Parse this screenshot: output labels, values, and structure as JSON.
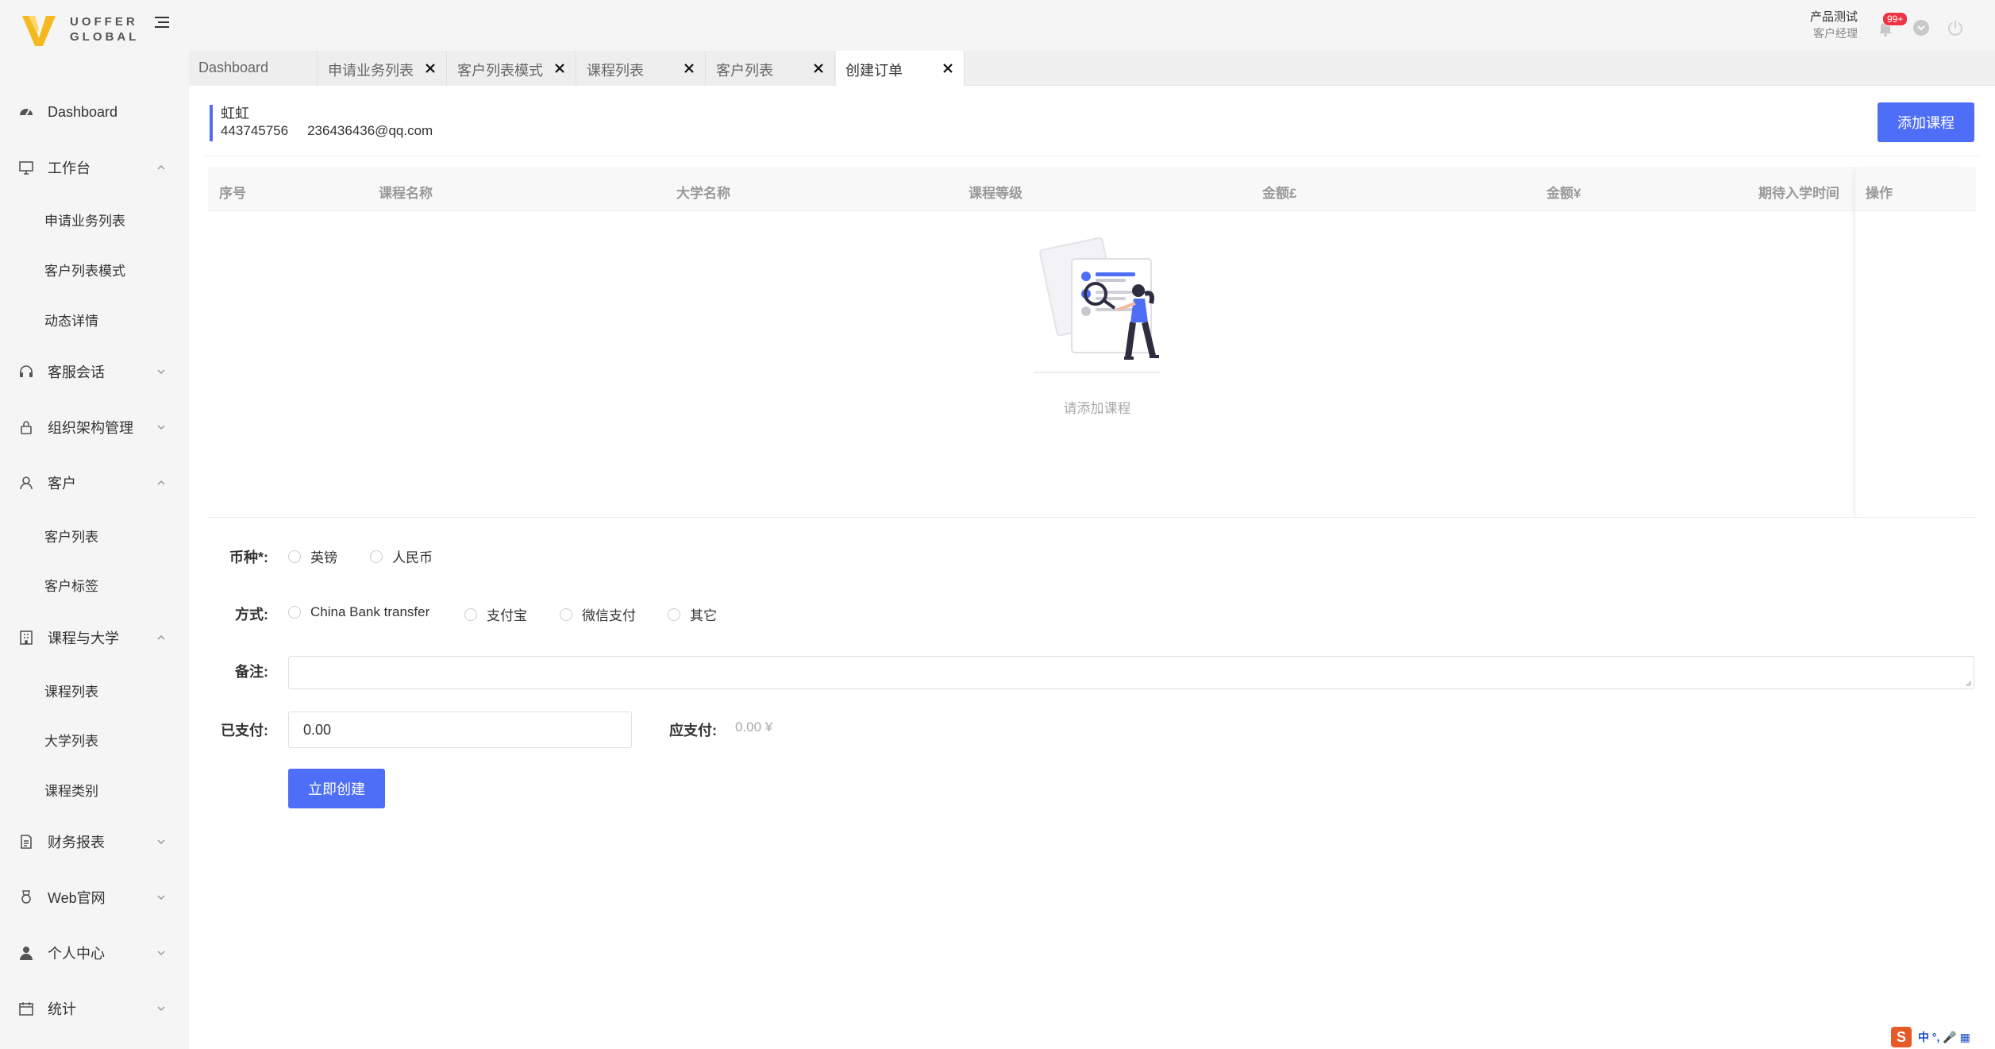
{
  "app": {
    "logo_line1": "UOFFER",
    "logo_line2": "GLOBAL",
    "brand_color": "#f5b81f"
  },
  "sidebar": {
    "items": [
      {
        "label": "Dashboard",
        "icon": "dashboard-icon"
      },
      {
        "label": "工作台",
        "icon": "monitor-icon",
        "expanded": true
      },
      {
        "label": "申请业务列表"
      },
      {
        "label": "客户列表模式"
      },
      {
        "label": "动态详情"
      },
      {
        "label": "客服会话",
        "icon": "headset-icon",
        "expanded": false
      },
      {
        "label": "组织架构管理",
        "icon": "lock-icon",
        "expanded": false
      },
      {
        "label": "客户",
        "icon": "user-icon",
        "expanded": true
      },
      {
        "label": "客户列表"
      },
      {
        "label": "客户标签"
      },
      {
        "label": "课程与大学",
        "icon": "building-icon",
        "expanded": true
      },
      {
        "label": "课程列表"
      },
      {
        "label": "大学列表"
      },
      {
        "label": "课程类别"
      },
      {
        "label": "财务报表",
        "icon": "document-icon",
        "expanded": false
      },
      {
        "label": "Web官网",
        "icon": "medal-icon",
        "expanded": false
      },
      {
        "label": "个人中心",
        "icon": "person-icon",
        "expanded": false
      },
      {
        "label": "统计",
        "icon": "calendar-icon",
        "expanded": false
      }
    ]
  },
  "header": {
    "user_name": "产品测试",
    "user_role": "客户经理",
    "notification_badge": "99+"
  },
  "tabs": [
    {
      "label": "Dashboard",
      "closable": false,
      "active": false
    },
    {
      "label": "申请业务列表",
      "closable": true,
      "active": false
    },
    {
      "label": "客户列表模式",
      "closable": true,
      "active": false
    },
    {
      "label": "课程列表",
      "closable": true,
      "active": false
    },
    {
      "label": "客户列表",
      "closable": true,
      "active": false
    },
    {
      "label": "创建订单",
      "closable": true,
      "active": true
    }
  ],
  "customer": {
    "name": "虹虹",
    "phone": "443745756",
    "email": "236436436@qq.com"
  },
  "add_course_button": "添加课程",
  "table": {
    "columns": [
      "序号",
      "课程名称",
      "大学名称",
      "课程等级",
      "金额£",
      "金额¥",
      "期待入学时间",
      "操作"
    ],
    "empty_text": "请添加课程"
  },
  "form": {
    "currency_label": "币种*:",
    "currency_options": [
      "英镑",
      "人民币"
    ],
    "method_label": "方式:",
    "method_options": [
      "China Bank transfer",
      "支付宝",
      "微信支付",
      "其它"
    ],
    "remark_label": "备注:",
    "paid_label": "已支付:",
    "paid_value": "0.00",
    "due_label": "应支付:",
    "due_value": "0.00 ¥",
    "submit_label": "立即创建"
  },
  "ime": {
    "logo": "S",
    "text": "中 °, 🎤 ▦"
  },
  "colors": {
    "accent": "#4f6ef7",
    "badge": "#ee3344",
    "sidebar_bg": "#f5f5f5"
  }
}
